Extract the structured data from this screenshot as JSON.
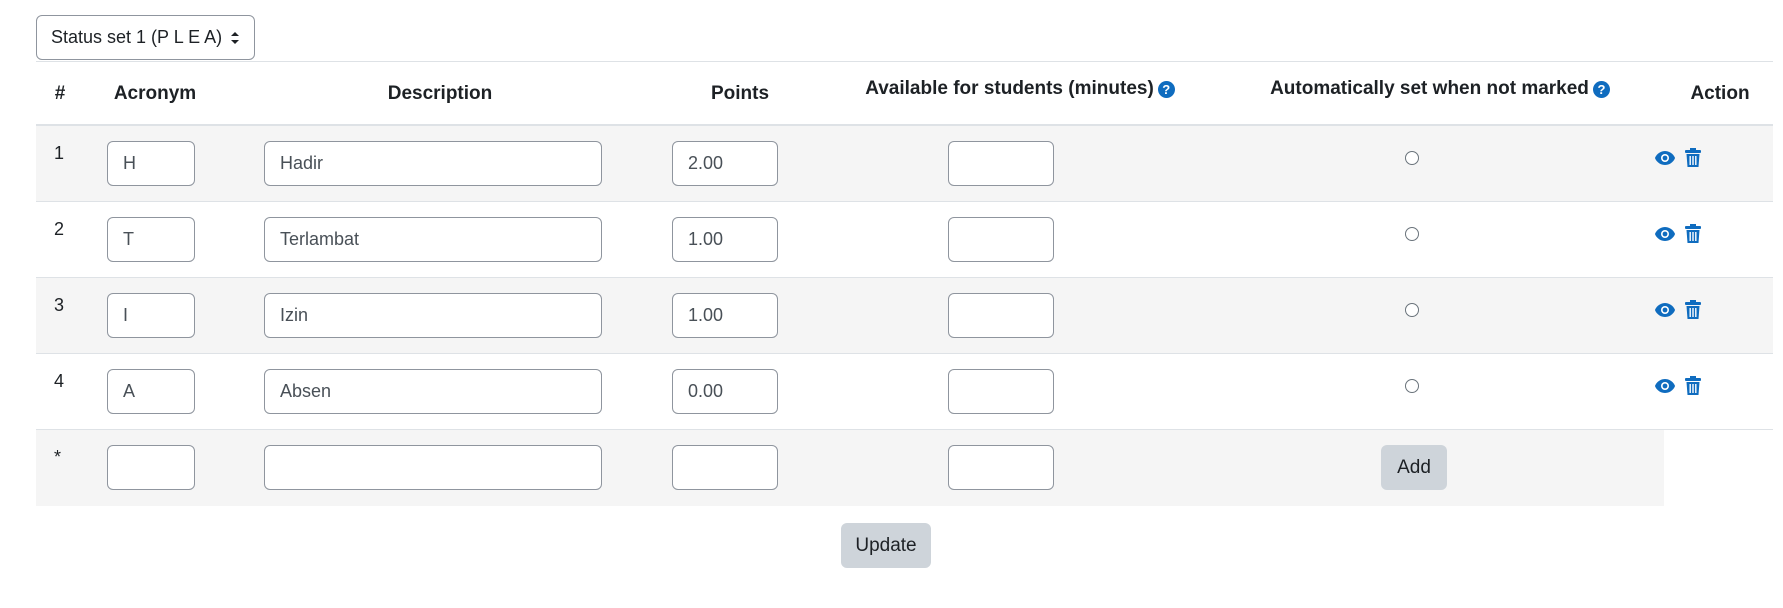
{
  "status_set": {
    "selected": "Status set 1 (P L E A)"
  },
  "table": {
    "headers": {
      "num": "#",
      "acronym": "Acronym",
      "description": "Description",
      "points": "Points",
      "available": "Available for students (minutes)",
      "auto_set": "Automatically set when not marked",
      "action": "Action"
    },
    "rows": [
      {
        "num": "1",
        "acronym": "H",
        "description": "Hadir",
        "points": "2.00",
        "available": ""
      },
      {
        "num": "2",
        "acronym": "T",
        "description": "Terlambat",
        "points": "1.00",
        "available": ""
      },
      {
        "num": "3",
        "acronym": "I",
        "description": "Izin",
        "points": "1.00",
        "available": ""
      },
      {
        "num": "4",
        "acronym": "A",
        "description": "Absen",
        "points": "0.00",
        "available": ""
      }
    ],
    "new_row": {
      "num": "*",
      "acronym": "",
      "description": "",
      "points": "",
      "available": "",
      "add_label": "Add"
    }
  },
  "icons": {
    "help": "question-circle-icon",
    "show": "eye-icon",
    "delete": "trash-icon",
    "select": "chevron-updown-icon"
  },
  "colors": {
    "accent": "#0f6cbf",
    "button_bg": "#ced4da",
    "stripe": "#f5f5f5"
  },
  "update_label": "Update"
}
